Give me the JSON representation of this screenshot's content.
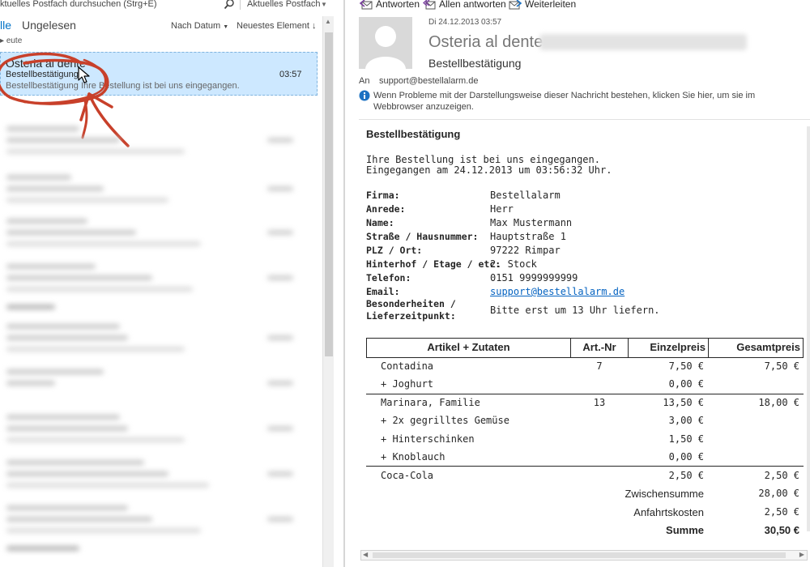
{
  "search": {
    "placeholder": "ktuelles Postfach durchsuchen (Strg+E)",
    "scope": "Aktuelles Postfach"
  },
  "filters": {
    "all": "lle",
    "unread": "Ungelesen"
  },
  "sort": {
    "by_date": "Nach Datum",
    "order": "Neuestes Element"
  },
  "group": {
    "today": "eute"
  },
  "selected_mail": {
    "sender": "Osteria al dente",
    "subject": "Bestellbestätigung",
    "preview": "Bestellbestätigung   Ihre Bestellung ist bei uns eingegangen.",
    "time": "03:57"
  },
  "toolbar": {
    "reply": "Antworten",
    "reply_all": "Allen antworten",
    "forward": "Weiterleiten"
  },
  "message": {
    "date": "Di 24.12.2013 03:57",
    "sender": "Osteria al dente",
    "subject": "Bestellbestätigung",
    "to_label": "An",
    "to": "support@bestellalarm.de",
    "info": "Wenn Probleme mit der Darstellungsweise dieser Nachricht bestehen, klicken Sie hier, um sie im Webbrowser anzuzeigen."
  },
  "email_body": {
    "title": "Bestellbestätigung",
    "line1": "Ihre Bestellung ist bei uns eingegangen.",
    "line2": "Eingegangen am 24.12.2013 um 03:56:32 Uhr.",
    "fields": [
      {
        "label": "Firma:",
        "value": "Bestellalarm"
      },
      {
        "label": "Anrede:",
        "value": "Herr"
      },
      {
        "label": "Name:",
        "value": "Max Mustermann"
      },
      {
        "label": "Straße / Hausnummer:",
        "value": "Hauptstraße 1"
      },
      {
        "label": "PLZ / Ort:",
        "value": "97222 Rimpar"
      },
      {
        "label": "Hinterhof / Etage / etc:",
        "value": "2. Stock"
      },
      {
        "label": "Telefon:",
        "value": "0151 9999999999"
      },
      {
        "label": "Email:",
        "value": "support@bestellalarm.de"
      },
      {
        "label": "Besonderheiten /",
        "value": ""
      },
      {
        "label": "Lieferzeitpunkt:",
        "value": "Bitte erst um 13 Uhr liefern."
      }
    ]
  },
  "order": {
    "headers": [
      "Artikel + Zutaten",
      "Art.-Nr",
      "Einzelpreis",
      "Gesamtpreis"
    ],
    "rows": [
      {
        "item": "Contadina",
        "art": "7",
        "unit": "7,50 €",
        "total": "7,50 €"
      },
      {
        "item": "+ Joghurt",
        "art": "",
        "unit": "0,00 €",
        "total": ""
      },
      {
        "item": "Marinara, Familie",
        "art": "13",
        "unit": "13,50 €",
        "total": "18,00 €"
      },
      {
        "item": "+ 2x gegrilltes Gemüse",
        "art": "",
        "unit": "3,00 €",
        "total": ""
      },
      {
        "item": "+ Hinterschinken",
        "art": "",
        "unit": "1,50 €",
        "total": ""
      },
      {
        "item": "+ Knoblauch",
        "art": "",
        "unit": "0,00 €",
        "total": ""
      },
      {
        "item": "Coca-Cola",
        "art": "",
        "unit": "2,50 €",
        "total": "2,50 €"
      }
    ],
    "subtotal_label": "Zwischensumme",
    "subtotal": "28,00 €",
    "delivery_label": "Anfahrtskosten",
    "delivery": "2,50 €",
    "sum_label": "Summe",
    "sum": "30,50 €"
  },
  "colors": {
    "accent": "#0072c6",
    "selection": "#cde8ff",
    "annotation": "#c8402a",
    "link": "#0563c1"
  }
}
